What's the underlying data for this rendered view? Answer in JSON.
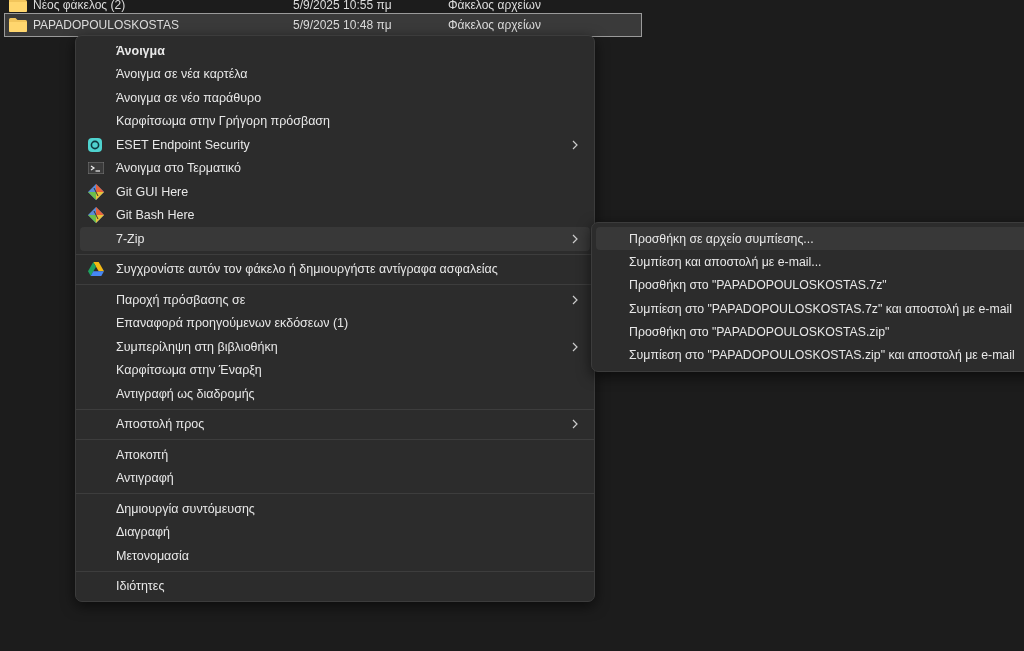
{
  "file_list": {
    "rows": [
      {
        "name": "Νέος φάκελος (2)",
        "date": "5/9/2025 10:55 πμ",
        "type": "Φάκελος αρχείων",
        "selected": false
      },
      {
        "name": "PAPADOPOULOSKOSTAS",
        "date": "5/9/2025 10:48 πμ",
        "type": "Φάκελος αρχείων",
        "selected": true
      }
    ]
  },
  "context_menu": {
    "sections": [
      {
        "items": [
          {
            "label": "Άνοιγμα",
            "kind": "plain",
            "bold": true,
            "submenu": false,
            "selected": false
          },
          {
            "label": "Άνοιγμα σε νέα καρτέλα",
            "kind": "plain",
            "bold": false,
            "submenu": false,
            "selected": false
          },
          {
            "label": "Άνοιγμα σε νέο παράθυρο",
            "kind": "plain",
            "bold": false,
            "submenu": false,
            "selected": false
          },
          {
            "label": "Καρφίτσωμα στην Γρήγορη πρόσβαση",
            "kind": "plain",
            "bold": false,
            "submenu": false,
            "selected": false
          },
          {
            "label": "ESET Endpoint Security",
            "kind": "eset",
            "bold": false,
            "submenu": true,
            "selected": false
          },
          {
            "label": "Άνοιγμα στο Τερματικό",
            "kind": "terminal",
            "bold": false,
            "submenu": false,
            "selected": false
          },
          {
            "label": "Git GUI Here",
            "kind": "git",
            "bold": false,
            "submenu": false,
            "selected": false
          },
          {
            "label": "Git Bash Here",
            "kind": "git",
            "bold": false,
            "submenu": false,
            "selected": false
          },
          {
            "label": "7-Zip",
            "kind": "plain",
            "bold": false,
            "submenu": true,
            "selected": true
          }
        ]
      },
      {
        "items": [
          {
            "label": "Συγχρονίστε αυτόν τον φάκελο ή δημιουργήστε αντίγραφα ασφαλείας",
            "kind": "drive",
            "bold": false,
            "submenu": false,
            "selected": false
          }
        ]
      },
      {
        "items": [
          {
            "label": "Παροχή πρόσβασης σε",
            "kind": "plain",
            "bold": false,
            "submenu": true,
            "selected": false
          },
          {
            "label": "Επαναφορά προηγούμενων εκδόσεων (1)",
            "kind": "plain",
            "bold": false,
            "submenu": false,
            "selected": false
          },
          {
            "label": "Συμπερίληψη στη βιβλιοθήκη",
            "kind": "plain",
            "bold": false,
            "submenu": true,
            "selected": false
          },
          {
            "label": "Καρφίτσωμα στην Έναρξη",
            "kind": "plain",
            "bold": false,
            "submenu": false,
            "selected": false
          },
          {
            "label": "Αντιγραφή ως διαδρομής",
            "kind": "plain",
            "bold": false,
            "submenu": false,
            "selected": false
          }
        ]
      },
      {
        "items": [
          {
            "label": "Αποστολή προς",
            "kind": "plain",
            "bold": false,
            "submenu": true,
            "selected": false
          }
        ]
      },
      {
        "items": [
          {
            "label": "Αποκοπή",
            "kind": "plain",
            "bold": false,
            "submenu": false,
            "selected": false
          },
          {
            "label": "Αντιγραφή",
            "kind": "plain",
            "bold": false,
            "submenu": false,
            "selected": false
          }
        ]
      },
      {
        "items": [
          {
            "label": "Δημιουργία συντόμευσης",
            "kind": "plain",
            "bold": false,
            "submenu": false,
            "selected": false
          },
          {
            "label": "Διαγραφή",
            "kind": "plain",
            "bold": false,
            "submenu": false,
            "selected": false
          },
          {
            "label": "Μετονομασία",
            "kind": "plain",
            "bold": false,
            "submenu": false,
            "selected": false
          }
        ]
      },
      {
        "items": [
          {
            "label": "Ιδιότητες",
            "kind": "plain",
            "bold": false,
            "submenu": false,
            "selected": false
          }
        ]
      }
    ]
  },
  "submenu": {
    "items": [
      {
        "label": "Προσθήκη σε αρχείο συμπίεσης...",
        "selected": true
      },
      {
        "label": "Συμπίεση και αποστολή με e-mail...",
        "selected": false
      },
      {
        "label": "Προσθήκη στο \"PAPADOPOULOSKOSTAS.7z\"",
        "selected": false
      },
      {
        "label": "Συμπίεση στο \"PAPADOPOULOSKOSTAS.7z\" και αποστολή με e-mail",
        "selected": false
      },
      {
        "label": "Προσθήκη στο \"PAPADOPOULOSKOSTAS.zip\"",
        "selected": false
      },
      {
        "label": "Συμπίεση στο \"PAPADOPOULOSKOSTAS.zip\" και αποστολή με e-mail",
        "selected": false
      }
    ]
  }
}
